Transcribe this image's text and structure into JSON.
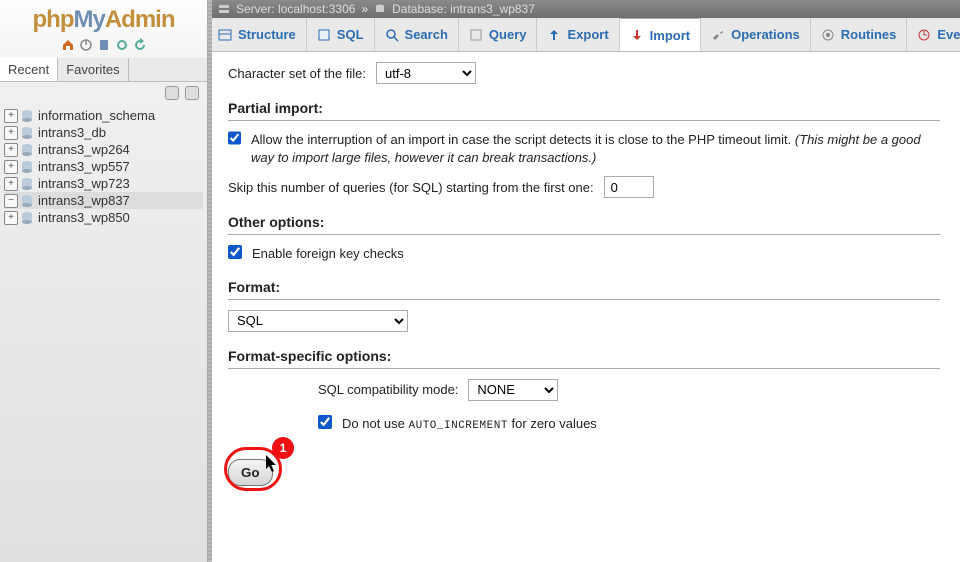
{
  "logo": {
    "part1": "php",
    "part2": "My",
    "part3": "Admin"
  },
  "breadcrumb": {
    "server_label": "Server:",
    "server_value": "localhost:3306",
    "sep": "»",
    "database_label": "Database:",
    "database_value": "intrans3_wp837"
  },
  "side_tabs": {
    "recent": "Recent",
    "favorites": "Favorites"
  },
  "tree": {
    "items": [
      {
        "label": "information_schema",
        "expanded": false,
        "selected": false
      },
      {
        "label": "intrans3_db",
        "expanded": false,
        "selected": false
      },
      {
        "label": "intrans3_wp264",
        "expanded": false,
        "selected": false
      },
      {
        "label": "intrans3_wp557",
        "expanded": false,
        "selected": false
      },
      {
        "label": "intrans3_wp723",
        "expanded": false,
        "selected": false
      },
      {
        "label": "intrans3_wp837",
        "expanded": true,
        "selected": true
      },
      {
        "label": "intrans3_wp850",
        "expanded": false,
        "selected": false
      }
    ]
  },
  "tabs": {
    "structure": "Structure",
    "sql": "SQL",
    "search": "Search",
    "query": "Query",
    "export": "Export",
    "import": "Import",
    "operations": "Operations",
    "routines": "Routines",
    "events": "Events"
  },
  "charset": {
    "label": "Character set of the file:",
    "selected": "utf-8"
  },
  "sections": {
    "partial": "Partial import:",
    "other": "Other options:",
    "format": "Format:",
    "formatopts": "Format-specific options:"
  },
  "partial_import": {
    "checkbox_label_main": "Allow the interruption of an import in case the script detects it is close to the PHP timeout limit.",
    "checkbox_label_note": " (This might be a good way to import large files, however it can break transactions.)",
    "checked": true,
    "skip_label": "Skip this number of queries (for SQL) starting from the first one:",
    "skip_value": "0"
  },
  "other_options": {
    "fk_label": "Enable foreign key checks",
    "fk_checked": true
  },
  "format": {
    "selected": "SQL"
  },
  "format_specific": {
    "compat_label": "SQL compatibility mode:",
    "compat_selected": "NONE",
    "autoinc_pre": "Do not use ",
    "autoinc_token": "AUTO_INCREMENT",
    "autoinc_post": " for zero values",
    "autoinc_checked": true
  },
  "go_button": "Go",
  "annotation": {
    "number": "1"
  }
}
